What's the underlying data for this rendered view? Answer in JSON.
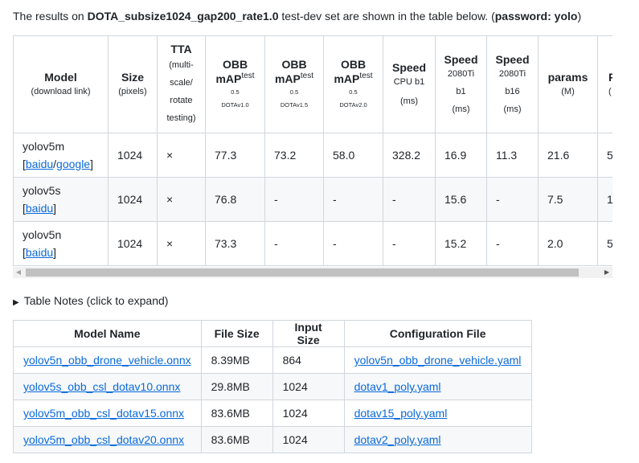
{
  "intro": {
    "prefix": "The results on ",
    "dataset": "DOTA_subsize1024_gap200_rate1.0",
    "middle": " test-dev set are shown in the table below. (",
    "password": "password: yolo",
    "suffix": ")"
  },
  "results": {
    "headers": {
      "model": {
        "main": "Model",
        "sub": "(download link)"
      },
      "size": {
        "main": "Size",
        "sub": "(pixels)"
      },
      "tta": {
        "main": "TTA",
        "sub": [
          "(multi-",
          "scale/",
          "rotate",
          "testing)"
        ]
      },
      "obb1": {
        "main": "OBB",
        "main2": "mAP",
        "sup": "test",
        "a": "0.5",
        "b": "DOTAv1.0"
      },
      "obb2": {
        "main": "OBB",
        "main2": "mAP",
        "sup": "test",
        "a": "0.5",
        "b": "DOTAv1.5"
      },
      "obb3": {
        "main": "OBB",
        "main2": "mAP",
        "sup": "test",
        "a": "0.5",
        "b": "DOTAv2.0"
      },
      "cpu": {
        "main": "Speed",
        "sub": "CPU b1",
        "sub2": "(ms)"
      },
      "gpu1": {
        "main": "Speed",
        "sub": "2080Ti",
        "sub2": "b1",
        "sub3": "(ms)"
      },
      "gpu16": {
        "main": "Speed",
        "sub": "2080Ti",
        "sub2": "b16",
        "sub3": "(ms)"
      },
      "params": {
        "main": "params",
        "sub": "(M)"
      },
      "flops": {
        "main": "F",
        "sub": "("
      }
    },
    "rows": [
      {
        "model": "yolov5m",
        "links": [
          {
            "text": "baidu"
          },
          {
            "text": "google"
          }
        ],
        "size": "1024",
        "tta": "×",
        "obb1": "77.3",
        "obb2": "73.2",
        "obb3": "58.0",
        "cpu": "328.2",
        "gpu1": "16.9",
        "gpu16": "11.3",
        "params": "21.6",
        "flops": "5"
      },
      {
        "model": "yolov5s",
        "links": [
          {
            "text": "baidu"
          }
        ],
        "size": "1024",
        "tta": "×",
        "obb1": "76.8",
        "obb2": "-",
        "obb3": "-",
        "cpu": "-",
        "gpu1": "15.6",
        "gpu16": "-",
        "params": "7.5",
        "flops": "1"
      },
      {
        "model": "yolov5n",
        "links": [
          {
            "text": "baidu"
          }
        ],
        "size": "1024",
        "tta": "×",
        "obb1": "73.3",
        "obb2": "-",
        "obb3": "-",
        "cpu": "-",
        "gpu1": "15.2",
        "gpu16": "-",
        "params": "2.0",
        "flops": "5"
      }
    ]
  },
  "notes": {
    "label": "Table Notes (click to expand)"
  },
  "files": {
    "headers": {
      "name": "Model Name",
      "size": "File Size",
      "input": "Input Size",
      "config": "Configuration File"
    },
    "rows": [
      {
        "name": "yolov5n_obb_drone_vehicle.onnx",
        "size": "8.39MB",
        "input": "864",
        "config": "yolov5n_obb_drone_vehicle.yaml"
      },
      {
        "name": "yolov5s_obb_csl_dotav10.onnx",
        "size": "29.8MB",
        "input": "1024",
        "config": "dotav1_poly.yaml"
      },
      {
        "name": "yolov5m_obb_csl_dotav15.onnx",
        "size": "83.6MB",
        "input": "1024",
        "config": "dotav15_poly.yaml"
      },
      {
        "name": "yolov5m_obb_csl_dotav20.onnx",
        "size": "83.6MB",
        "input": "1024",
        "config": "dotav2_poly.yaml"
      }
    ]
  },
  "scrollbar": {
    "left_arrow": "◀",
    "right_arrow": "▶"
  },
  "colors": {
    "link": "#0969da",
    "border": "#d0d7de",
    "alt_row": "#f6f8fa"
  }
}
